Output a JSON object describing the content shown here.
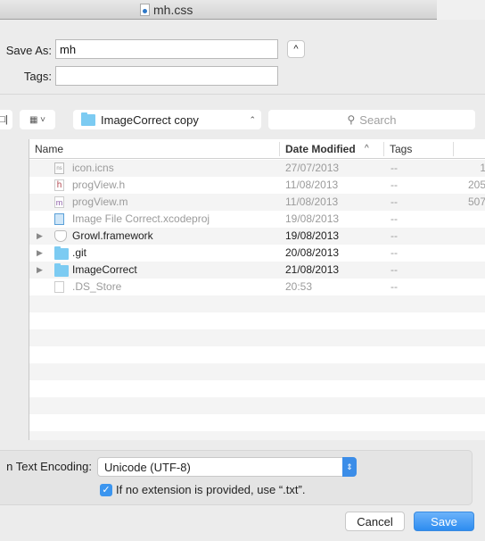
{
  "window": {
    "title": "mh.css"
  },
  "form": {
    "save_as_label": "Save As:",
    "save_as_value": "mh",
    "tags_label": "Tags:",
    "tags_value": "",
    "collapse_glyph": "^"
  },
  "toolbar": {
    "view_glyph": "□|",
    "arrange_glyph": "▦ ˅",
    "location": "ImageCorrect copy",
    "location_glyph": "⌃⌄",
    "search_placeholder": "Search",
    "search_glyph": "⚲"
  },
  "columns": {
    "name": "Name",
    "date": "Date Modified",
    "tags": "Tags",
    "sort_glyph": "^"
  },
  "files": [
    {
      "name": "icon.icns",
      "date": "27/07/2013",
      "tags": "--",
      "size": "1",
      "icon": "icns-file-icon",
      "enabled": false,
      "folder": false
    },
    {
      "name": "progView.h",
      "date": "11/08/2013",
      "tags": "--",
      "size": "205",
      "icon": "header-file-icon",
      "enabled": false,
      "folder": false
    },
    {
      "name": "progView.m",
      "date": "11/08/2013",
      "tags": "--",
      "size": "507",
      "icon": "objc-file-icon",
      "enabled": false,
      "folder": false
    },
    {
      "name": "Image File Correct.xcodeproj",
      "date": "19/08/2013",
      "tags": "--",
      "size": "",
      "icon": "xcodeproj-icon",
      "enabled": false,
      "folder": false
    },
    {
      "name": "Growl.framework",
      "date": "19/08/2013",
      "tags": "--",
      "size": "",
      "icon": "framework-icon",
      "enabled": true,
      "folder": true
    },
    {
      "name": ".git",
      "date": "20/08/2013",
      "tags": "--",
      "size": "",
      "icon": "folder-icon",
      "enabled": true,
      "folder": true
    },
    {
      "name": "ImageCorrect",
      "date": "21/08/2013",
      "tags": "--",
      "size": "",
      "icon": "folder-icon",
      "enabled": true,
      "folder": true
    },
    {
      "name": ".DS_Store",
      "date": "20:53",
      "tags": "--",
      "size": "",
      "icon": "blank-file-icon",
      "enabled": false,
      "folder": false
    }
  ],
  "options": {
    "encoding_label": "n Text Encoding:",
    "encoding_value": "Unicode (UTF-8)",
    "checkbox_label": "If no extension is provided, use “.txt”.",
    "checkbox_checked": true,
    "check_glyph": "✓"
  },
  "buttons": {
    "cancel": "Cancel",
    "save": "Save"
  },
  "colors": {
    "accent": "#3b95ef",
    "folder": "#7ccbf2"
  }
}
